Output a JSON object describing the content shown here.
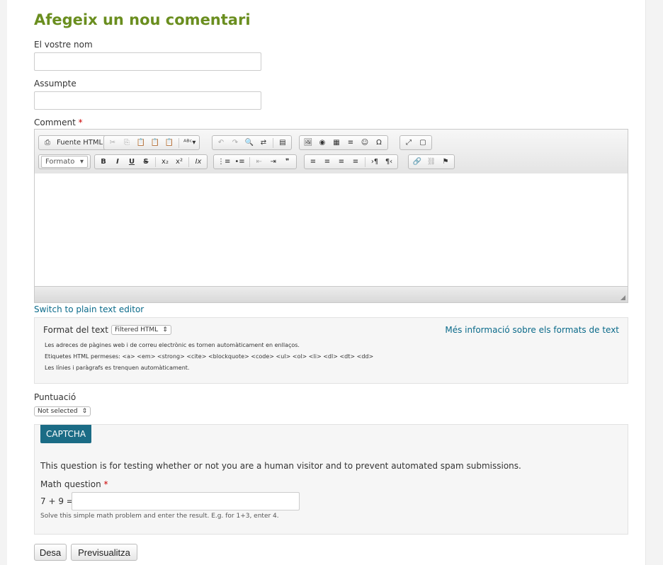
{
  "form": {
    "title": "Afegeix un nou comentari",
    "name_label": "El vostre nom",
    "name_value": "",
    "subject_label": "Assumpte",
    "subject_value": "",
    "comment_label": "Comment",
    "required_mark": "*"
  },
  "editor": {
    "source_button": "Fuente HTML",
    "format_combo": "Formato",
    "toolbar_row1": [
      "✂",
      "⎘",
      "📋",
      "📋",
      "📋",
      "ᴬᴮᶜ▾",
      "↶",
      "↷",
      "🔍",
      "⇄",
      "▤",
      "🖼",
      "◉",
      "▦",
      "≡",
      "☺",
      "Ω",
      "⤢",
      "▢"
    ],
    "toolbar_row2": [
      "B",
      "I",
      "U",
      "S",
      "x₂",
      "x²",
      "Ix",
      "⋮≡",
      "•≡",
      "⇤",
      "⇥",
      "❞",
      "≡",
      "≡",
      "≡",
      "≡",
      "›¶",
      "¶‹",
      "🔗",
      "⛓",
      "⚑"
    ],
    "body_text": "",
    "switch_link": "Switch to plain text editor"
  },
  "text_format": {
    "label": "Format del text",
    "selected": "Filtered HTML",
    "more_info_link": "Més informació sobre els formats de text",
    "tips": [
      "Les adreces de pàgines web i de correu electrònic es tornen automàticament en enllaços.",
      "Etiquetes HTML permeses: <a> <em> <strong> <cite> <blockquote> <code> <ul> <ol> <li> <dl> <dt> <dd>",
      "Les línies i paràgrafs es trenquen automàticament."
    ]
  },
  "rating": {
    "label": "Puntuació",
    "selected": "Not selected"
  },
  "captcha": {
    "legend": "CAPTCHA",
    "description": "This question is for testing whether or not you are a human visitor and to prevent automated spam submissions.",
    "question_label": "Math question",
    "question": "7 + 9 =",
    "answer_value": "",
    "help": "Solve this simple math problem and enter the result. E.g. for 1+3, enter 4."
  },
  "actions": {
    "save": "Desa",
    "preview": "Previsualitza"
  },
  "colors": {
    "title": "#6a8e1f",
    "link": "#0a6a8a",
    "captcha_legend": "#1b6c86",
    "required": "#cc0000"
  }
}
